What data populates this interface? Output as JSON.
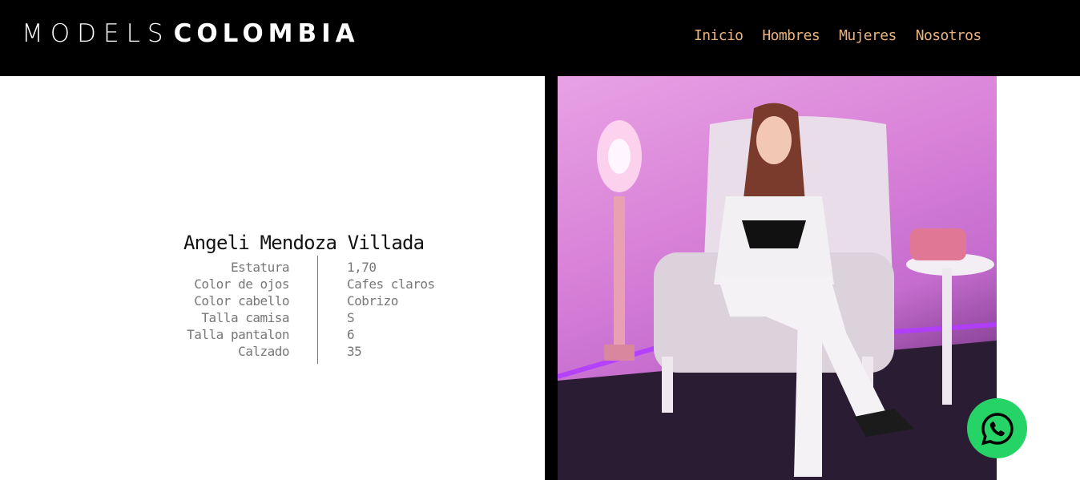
{
  "header": {
    "logo_light": "MODELS",
    "logo_bold": "COLOMBIA",
    "nav": [
      {
        "label": "Inicio"
      },
      {
        "label": "Hombres"
      },
      {
        "label": "Mujeres"
      },
      {
        "label": "Nosotros"
      }
    ]
  },
  "profile": {
    "name": "Angeli Mendoza Villada",
    "specs": [
      {
        "label": "Estatura",
        "value": "1,70"
      },
      {
        "label": "Color de ojos",
        "value": "Cafes claros"
      },
      {
        "label": "Color cabello",
        "value": "Cobrizo"
      },
      {
        "label": "Talla camisa",
        "value": "S"
      },
      {
        "label": "Talla pantalon",
        "value": "6"
      },
      {
        "label": "Calzado",
        "value": "35"
      }
    ]
  },
  "colors": {
    "header_bg": "#000000",
    "nav_text": "#e9b27e",
    "whatsapp": "#25d366"
  },
  "icons": {
    "whatsapp": "whatsapp-icon"
  }
}
